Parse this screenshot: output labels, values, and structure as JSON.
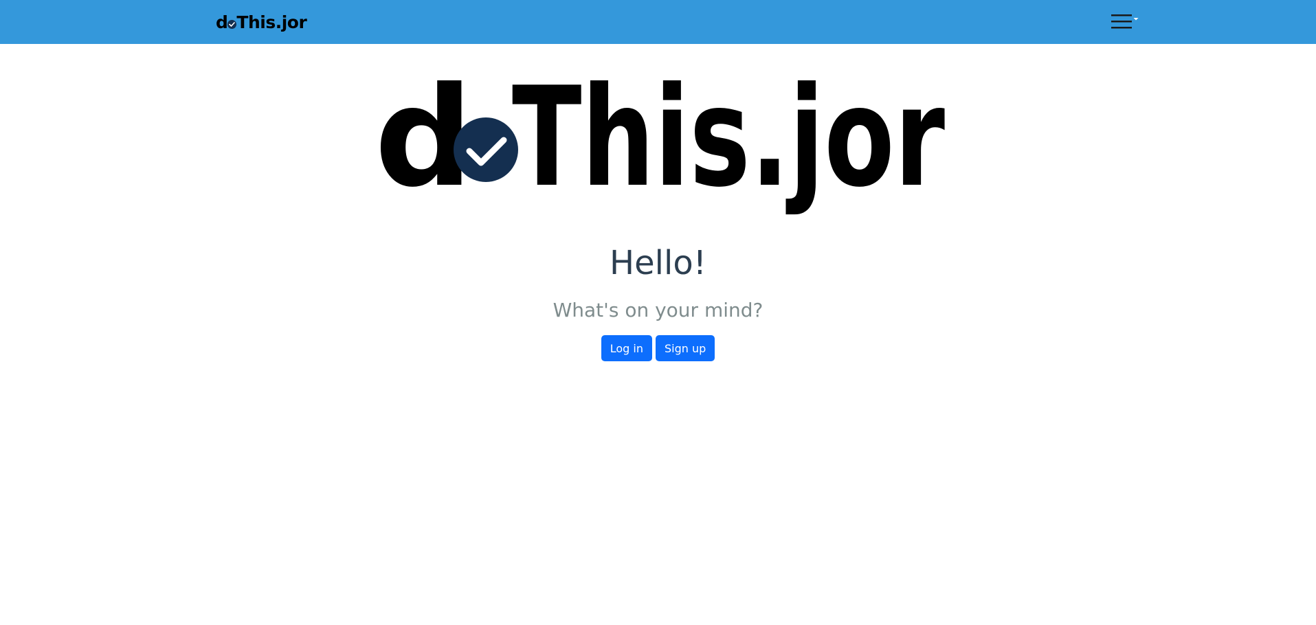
{
  "navbar": {
    "brand": {
      "prefix": "d",
      "suffix": "This.jor"
    },
    "menu_icon": "hamburger-menu-icon",
    "menu_caret_icon": "caret-down-icon",
    "background_color": "#3498db"
  },
  "hero": {
    "logo": {
      "prefix": "d",
      "suffix": "This.jor",
      "check_icon": "check-circle-icon",
      "check_color": "#142f50"
    },
    "greeting": "Hello!",
    "subtitle": "What's on your mind?"
  },
  "actions": {
    "login_label": "Log in",
    "signup_label": "Sign up",
    "button_color": "#0d6efd"
  }
}
